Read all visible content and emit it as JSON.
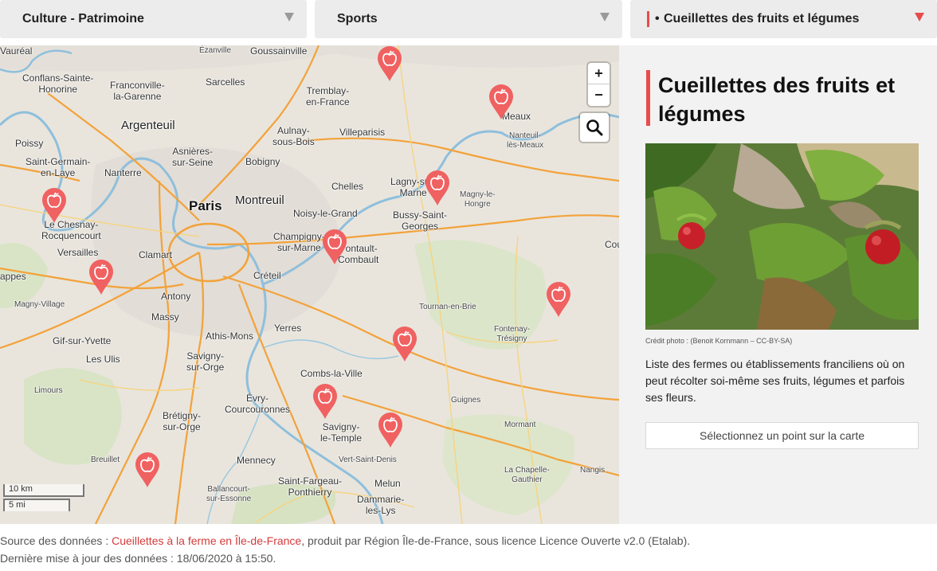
{
  "selectors": [
    {
      "label": "Culture - Patrimoine"
    },
    {
      "label": "Sports"
    },
    {
      "bullet": "•",
      "label": "Cueillettes des fruits et légumes"
    }
  ],
  "map": {
    "zoom_in": "+",
    "zoom_out": "−",
    "scale_km": "10 km",
    "scale_mi": "5 mi",
    "places": {
      "vaureal": "Vauréal",
      "ezanville": "Ézanville",
      "goussainville": "Goussainville",
      "conflans": "Conflans-Sainte-\nHonorine",
      "franconville": "Franconville-\nla-Garenne",
      "sarcelles": "Sarcelles",
      "tremblay": "Tremblay-\nen-France",
      "meaux": "Meaux",
      "argenteuil": "Argenteuil",
      "aulnay": "Aulnay-\nsous-Bois",
      "villepinte": "Villeparisis",
      "nanteuil": "Nanteuil-\nlès-Meaux",
      "poissy": "Poissy",
      "asnieres": "Asnières-\nsur-Seine",
      "bobigny": "Bobigny",
      "saintgermain": "Saint-Germain-\nen-Laye",
      "nanterre": "Nanterre",
      "chelles": "Chelles",
      "lagny": "Lagny-sur-\nMarne",
      "magny": "Magny-le-\nHongre",
      "paris": "Paris",
      "montreuil": "Montreuil",
      "noisy": "Noisy-le-Grand",
      "bussy": "Bussy-Saint-\nGeorges",
      "lechesnay": "Le Chesnay-\nRocquencourt",
      "versailles": "Versailles",
      "clamart": "Clamart",
      "champigny": "Champigny-\nsur-Marne",
      "pontault": "Pontault-\nCombault",
      "cou": "Cou",
      "appes": "appes",
      "creteil": "Créteil",
      "magnyvillage": "Magny-Village",
      "antony": "Antony",
      "tournan": "Tournan-en-Brie",
      "massy": "Massy",
      "fontenay": "Fontenay-\nTrésigny",
      "gif": "Gif-sur-Yvette",
      "athis": "Athis-Mons",
      "yerres": "Yerres",
      "lesulis": "Les Ulis",
      "savignyorge": "Savigny-\nsur-Orge",
      "combs": "Combs-la-Ville",
      "limours": "Limours",
      "evry": "Évry-\nCourcouronnes",
      "guignes": "Guignes",
      "bretigny": "Brétigny-\nsur-Orge",
      "mormant": "Mormant",
      "savignytemple": "Savigny-\nle-Temple",
      "breuillet": "Breuillet",
      "mennecy": "Mennecy",
      "vertsaintdenis": "Vert-Saint-Denis",
      "lachapelle": "La Chapelle-\nGauthier",
      "nangis": "Nangis",
      "saintfargeau": "Saint-Fargeau-\nPonthierry",
      "melun": "Melun",
      "ballancourt": "Ballancourt-\nsur-Essonne",
      "dammarie": "Dammarie-\nles-Lys"
    }
  },
  "sidebar": {
    "title": "Cueillettes des fruits et légumes",
    "photo_credit": "Crédit photo : (Benoit Kornmann – CC-BY-SA)",
    "description": "Liste des fermes ou établissements franciliens où on peut récolter soi-même ses fruits, légumes et parfois ses fleurs.",
    "select_point": "Sélectionnez un point sur la carte"
  },
  "footer": {
    "source_prefix": "Source des données : ",
    "source_link": "Cueillettes à la ferme en Île-de-France",
    "source_suffix": ", produit par Région Île-de-France, sous licence Licence Ouverte v2.0 (Etalab).",
    "updated": "Dernière mise à jour des données : 18/06/2020 à 15:50."
  },
  "colors": {
    "accent": "#e84c4c",
    "pin": "#f06161",
    "link": "#d43b3b"
  }
}
